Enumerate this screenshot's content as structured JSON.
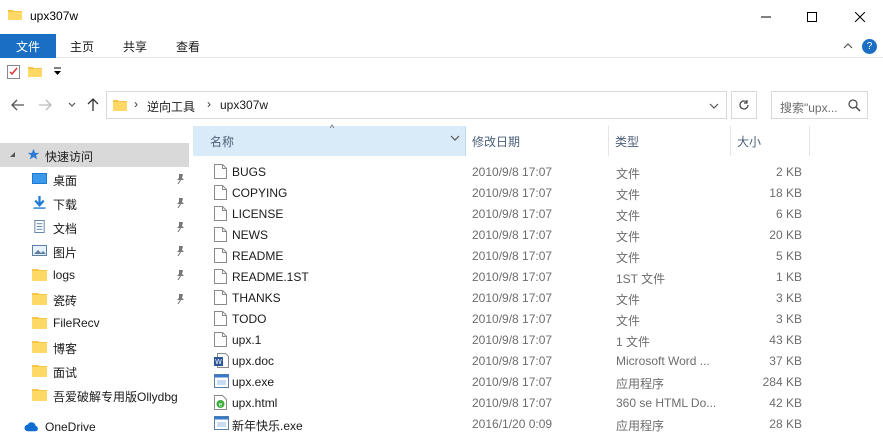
{
  "window": {
    "title": "upx307w"
  },
  "ribbon": {
    "file": "文件",
    "home": "主页",
    "share": "共享",
    "view": "查看"
  },
  "address": {
    "crumbs": [
      "逆向工具",
      "upx307w"
    ]
  },
  "search": {
    "placeholder": "搜索\"upx..."
  },
  "nav": {
    "quick_access": "快速访问",
    "items": [
      "桌面",
      "下载",
      "文档",
      "图片",
      "logs",
      "瓷砖",
      "FileRecv",
      "博客",
      "面试",
      "吾爱破解专用版Ollydbg"
    ],
    "onedrive": "OneDrive"
  },
  "columns": {
    "name": "名称",
    "date": "修改日期",
    "type": "类型",
    "size": "大小"
  },
  "files": [
    {
      "name": "BUGS",
      "date": "2010/9/8 17:07",
      "type": "文件",
      "size": "2 KB",
      "icon": "file-icon"
    },
    {
      "name": "COPYING",
      "date": "2010/9/8 17:07",
      "type": "文件",
      "size": "18 KB",
      "icon": "file-icon"
    },
    {
      "name": "LICENSE",
      "date": "2010/9/8 17:07",
      "type": "文件",
      "size": "6 KB",
      "icon": "file-icon"
    },
    {
      "name": "NEWS",
      "date": "2010/9/8 17:07",
      "type": "文件",
      "size": "20 KB",
      "icon": "file-icon"
    },
    {
      "name": "README",
      "date": "2010/9/8 17:07",
      "type": "文件",
      "size": "5 KB",
      "icon": "file-icon"
    },
    {
      "name": "README.1ST",
      "date": "2010/9/8 17:07",
      "type": "1ST 文件",
      "size": "1 KB",
      "icon": "file-icon"
    },
    {
      "name": "THANKS",
      "date": "2010/9/8 17:07",
      "type": "文件",
      "size": "3 KB",
      "icon": "file-icon"
    },
    {
      "name": "TODO",
      "date": "2010/9/8 17:07",
      "type": "文件",
      "size": "3 KB",
      "icon": "file-icon"
    },
    {
      "name": "upx.1",
      "date": "2010/9/8 17:07",
      "type": "1 文件",
      "size": "43 KB",
      "icon": "file-icon"
    },
    {
      "name": "upx.doc",
      "date": "2010/9/8 17:07",
      "type": "Microsoft Word ...",
      "size": "37 KB",
      "icon": "word-doc-icon"
    },
    {
      "name": "upx.exe",
      "date": "2010/9/8 17:07",
      "type": "应用程序",
      "size": "284 KB",
      "icon": "exe-icon"
    },
    {
      "name": "upx.html",
      "date": "2010/9/8 17:07",
      "type": "360 se HTML Do...",
      "size": "42 KB",
      "icon": "html-icon"
    },
    {
      "name": "新年快乐.exe",
      "date": "2016/1/20 0:09",
      "type": "应用程序",
      "size": "28 KB",
      "icon": "exe-icon"
    }
  ],
  "colors": {
    "accent": "#1a6fc4",
    "header_selected": "#d9ebf9",
    "nav_selected": "#d9d9d9",
    "folder": "#f5c54a"
  }
}
